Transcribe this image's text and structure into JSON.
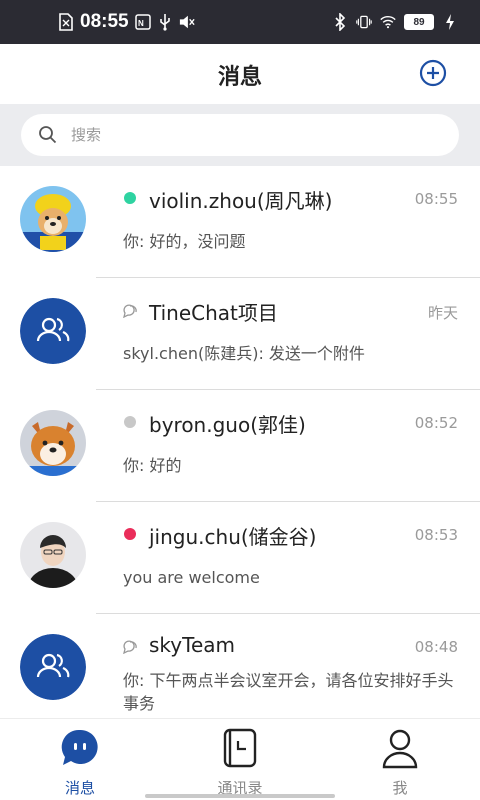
{
  "status_bar": {
    "time": "08:55",
    "battery": "89",
    "icons": [
      "sim-icon",
      "nfc-icon",
      "usb-icon",
      "volume-mute-icon",
      "bluetooth-icon",
      "vibrate-icon",
      "wifi-icon",
      "battery-icon",
      "charging-icon"
    ]
  },
  "header": {
    "title": "消息",
    "add_icon": "add-circle-icon"
  },
  "search": {
    "placeholder": "搜索",
    "icon": "search-icon"
  },
  "conversations": [
    {
      "name": "violin.zhou(周凡琳)",
      "time": "08:55",
      "preview": "你: 好的，没问题",
      "status_color": "#2ed3a1",
      "avatar": "dog-costume-avatar",
      "type": "person"
    },
    {
      "name": "TineChat项目",
      "time": "昨天",
      "preview": "skyl.chen(陈建兵): 发送一个附件",
      "avatar": "group-avatar",
      "type": "group"
    },
    {
      "name": "byron.guo(郭佳)",
      "time": "08:52",
      "preview": "你: 好的",
      "status_color": "#c8c8c8",
      "avatar": "shiba-avatar",
      "type": "person"
    },
    {
      "name": "jingu.chu(储金谷)",
      "time": "08:53",
      "preview": "you are welcome",
      "status_color": "#ea2d5a",
      "avatar": "person-photo-avatar",
      "type": "person"
    },
    {
      "name": "skyTeam",
      "time": "08:48",
      "preview": "你: 下午两点半会议室开会，请各位安排好手头事务",
      "avatar": "group-avatar",
      "type": "group"
    }
  ],
  "bottom_nav": [
    {
      "label": "消息",
      "icon": "chat-bubble-icon",
      "active": true
    },
    {
      "label": "通讯录",
      "icon": "contacts-book-icon",
      "active": false
    },
    {
      "label": "我",
      "icon": "person-icon",
      "active": false
    }
  ],
  "colors": {
    "accent": "#1d4fa4",
    "group_avatar": "#1d4fa4",
    "status_bar": "#2b2b33"
  }
}
